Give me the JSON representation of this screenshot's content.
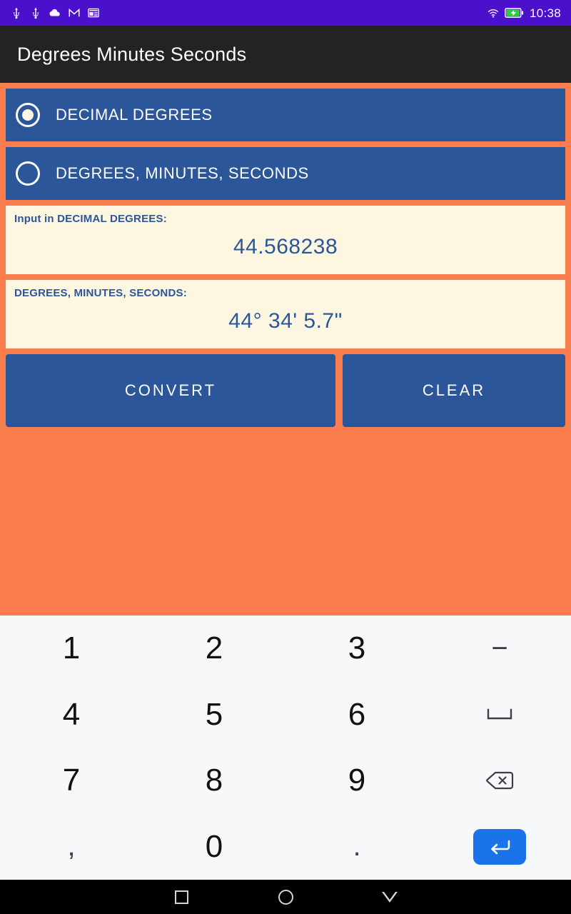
{
  "status_bar": {
    "background_color": "#4b10cc",
    "time": "10:38",
    "left_icons": [
      "usb-icon",
      "usb-icon",
      "cloud-icon",
      "gmail-icon",
      "news-icon"
    ],
    "right_icons": [
      "wifi-icon",
      "battery-charging-icon"
    ],
    "battery_color": "#2ecc40"
  },
  "app_bar": {
    "title": "Degrees Minutes Seconds",
    "background_color": "#232323"
  },
  "theme": {
    "background": "#fa7d4e",
    "panel_blue": "#2b5699",
    "field_cream": "#fdf6e0",
    "keyboard_bg": "#f7f8fa",
    "enter_key_blue": "#1a73e8"
  },
  "options": [
    {
      "label": "DECIMAL DEGREES",
      "selected": true
    },
    {
      "label": "DEGREES, MINUTES, SECONDS",
      "selected": false
    }
  ],
  "input_field": {
    "label": "Input in DECIMAL DEGREES:",
    "value": "44.568238",
    "placeholder": ""
  },
  "output_field": {
    "label": "DEGREES, MINUTES, SECONDS:",
    "value": "44°  34'  5.7\""
  },
  "actions": {
    "convert_label": "CONVERT",
    "clear_label": "CLEAR"
  },
  "keyboard": {
    "keys": [
      {
        "name": "key-1",
        "label": "1",
        "type": "digit"
      },
      {
        "name": "key-2",
        "label": "2",
        "type": "digit"
      },
      {
        "name": "key-3",
        "label": "3",
        "type": "digit"
      },
      {
        "name": "key-minus",
        "label": "−",
        "type": "symbol"
      },
      {
        "name": "key-4",
        "label": "4",
        "type": "digit"
      },
      {
        "name": "key-5",
        "label": "5",
        "type": "digit"
      },
      {
        "name": "key-6",
        "label": "6",
        "type": "digit"
      },
      {
        "name": "key-space",
        "label": "",
        "type": "space-icon"
      },
      {
        "name": "key-7",
        "label": "7",
        "type": "digit"
      },
      {
        "name": "key-8",
        "label": "8",
        "type": "digit"
      },
      {
        "name": "key-9",
        "label": "9",
        "type": "digit"
      },
      {
        "name": "key-backspace",
        "label": "",
        "type": "backspace-icon"
      },
      {
        "name": "key-comma",
        "label": ",",
        "type": "symbol"
      },
      {
        "name": "key-0",
        "label": "0",
        "type": "digit"
      },
      {
        "name": "key-period",
        "label": ".",
        "type": "symbol"
      },
      {
        "name": "key-enter",
        "label": "",
        "type": "enter-icon"
      }
    ]
  },
  "nav_bar": {
    "buttons": [
      "recents-square-icon",
      "home-circle-icon",
      "back-triangle-icon"
    ]
  }
}
